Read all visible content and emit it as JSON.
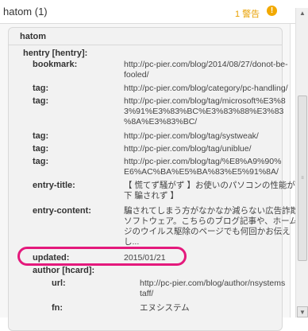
{
  "header": {
    "title": "hatom (1)",
    "warning": "1 警告",
    "warning_icon": "!"
  },
  "hatom": {
    "title": "hatom",
    "hentry_label": "hentry [hentry]:"
  },
  "rows": [
    {
      "key": "bookmark:",
      "lines": [
        "http://pc-pier.com/blog/2014/08/27/donot-be-",
        "fooled/"
      ]
    },
    {
      "key": "tag:",
      "lines": [
        "http://pc-pier.com/blog/category/pc-handling/"
      ]
    },
    {
      "key": "tag:",
      "lines": [
        "http://pc-pier.com/blog/tag/microsoft%E3%8",
        "3%91%E3%83%BC%E3%83%88%E3%83",
        "%8A%E3%83%BC/"
      ]
    },
    {
      "key": "tag:",
      "lines": [
        "http://pc-pier.com/blog/tag/systweak/"
      ]
    },
    {
      "key": "tag:",
      "lines": [
        "http://pc-pier.com/blog/tag/uniblue/"
      ]
    },
    {
      "key": "tag:",
      "lines": [
        "http://pc-pier.com/blog/tag/%E8%A9%90%",
        "E6%AC%BA%E5%BA%83%E5%91%8A/"
      ]
    },
    {
      "key": "entry-title:",
      "lines": [
        "【 慌てず騒がず 】お使いのパソコンの性能が低",
        "下 騙されず 】"
      ]
    },
    {
      "key": "entry-content:",
      "lines": [
        "騙されてしまう方がなかなか減らない広告詐欺",
        "ソフトウェア。こちらのブログ記事や、ホームペー",
        "ジのウイルス駆除のページでも何回かお伝え",
        "し..."
      ]
    },
    {
      "key": "updated:",
      "lines": [
        "2015/01/21"
      ]
    },
    {
      "key": "author [hcard]:",
      "lines": []
    }
  ],
  "author_rows": [
    {
      "key": "url:",
      "lines": [
        "http://pc-pier.com/blog/author/nsystems",
        "taff/"
      ]
    },
    {
      "key": "fn:",
      "lines": [
        "エヌシステム"
      ]
    }
  ],
  "colors": {
    "highlight": "#e4197c",
    "warning": "#e8a000"
  }
}
